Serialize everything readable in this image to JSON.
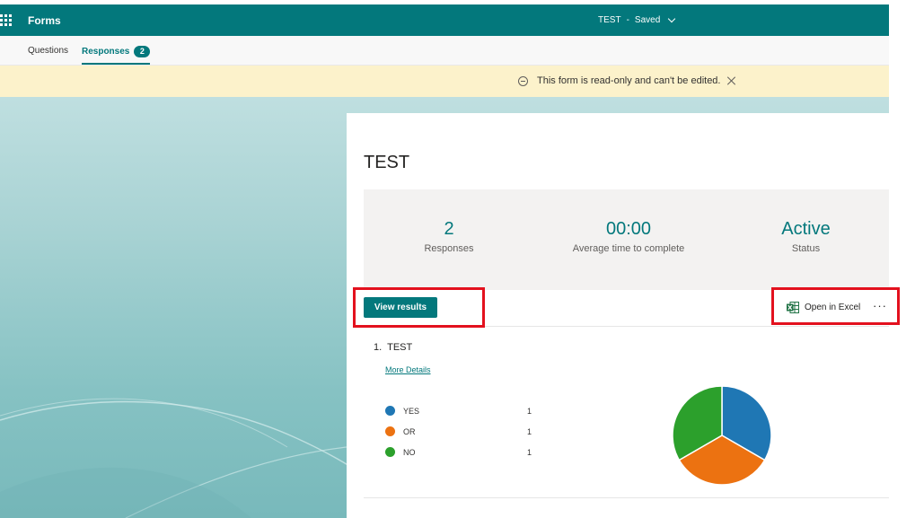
{
  "header": {
    "app_name": "Forms",
    "doc_title": "TEST",
    "separator": "-",
    "status": "Saved"
  },
  "tabs": [
    {
      "label": "Questions"
    },
    {
      "label": "Responses",
      "badge": "2"
    }
  ],
  "banner": {
    "text": "This form is read-only and can't be edited."
  },
  "form": {
    "title": "TEST"
  },
  "stats": [
    {
      "value": "2",
      "label": "Responses"
    },
    {
      "value": "00:00",
      "label": "Average time to complete"
    },
    {
      "value": "Active",
      "label": "Status"
    }
  ],
  "actions": {
    "view_results": "View results",
    "open_excel": "Open in Excel",
    "more": "···"
  },
  "question": {
    "number": "1.",
    "title": "TEST",
    "more_details": "More Details",
    "options": [
      {
        "label": "YES",
        "count": "1",
        "color": "#1f77b4"
      },
      {
        "label": "OR",
        "count": "1",
        "color": "#ec7211"
      },
      {
        "label": "NO",
        "count": "1",
        "color": "#2ca02c"
      }
    ]
  },
  "colors": {
    "accent": "#03787c",
    "banner": "#fcf2cb",
    "highlight": "#e3111e"
  }
}
